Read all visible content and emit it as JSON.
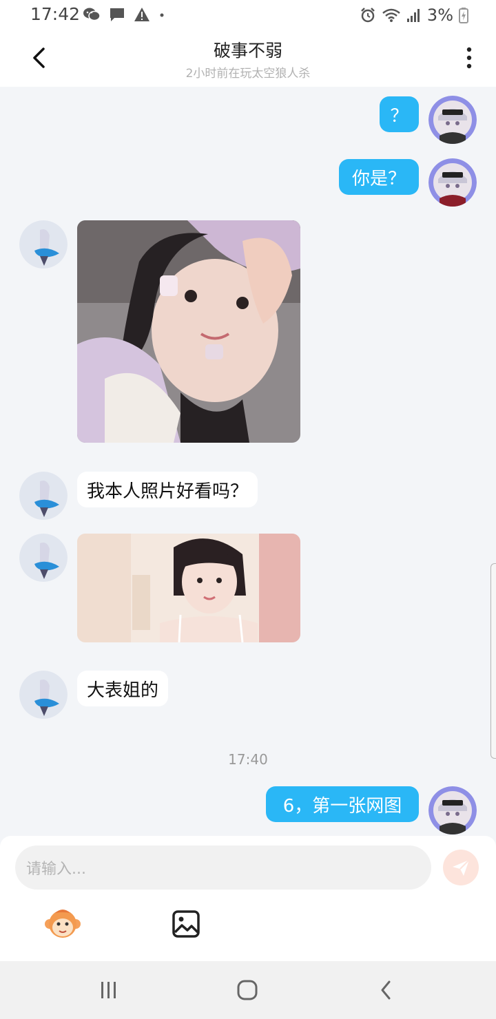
{
  "status_bar": {
    "time": "17:42",
    "battery": "3%",
    "left_icons": [
      "wechat-icon",
      "message-icon",
      "warning-icon",
      "dot-icon"
    ],
    "right_icons": [
      "alarm-icon",
      "wifi-icon",
      "signal-icon",
      "battery-icon"
    ]
  },
  "header": {
    "title": "破事不弱",
    "subtitle": "2小时前在玩太空狼人杀"
  },
  "messages": [
    {
      "from": "me",
      "type": "text",
      "text": "？"
    },
    {
      "from": "me",
      "type": "text",
      "text": "你是？"
    },
    {
      "from": "other",
      "type": "image"
    },
    {
      "from": "other",
      "type": "text",
      "text": "我本人照片好看吗？"
    },
    {
      "from": "other",
      "type": "image"
    },
    {
      "from": "other",
      "type": "text",
      "text": "大表姐的"
    },
    {
      "from": "me",
      "type": "text",
      "text": "6，第一张网图"
    }
  ],
  "time_separator": "17:40",
  "input": {
    "placeholder": "请输入..."
  },
  "colors": {
    "outgoing_bubble": "#2ab7f6",
    "incoming_bubble": "#ffffff",
    "chat_background": "#f3f5f8",
    "send_button": "#fde4dc"
  }
}
